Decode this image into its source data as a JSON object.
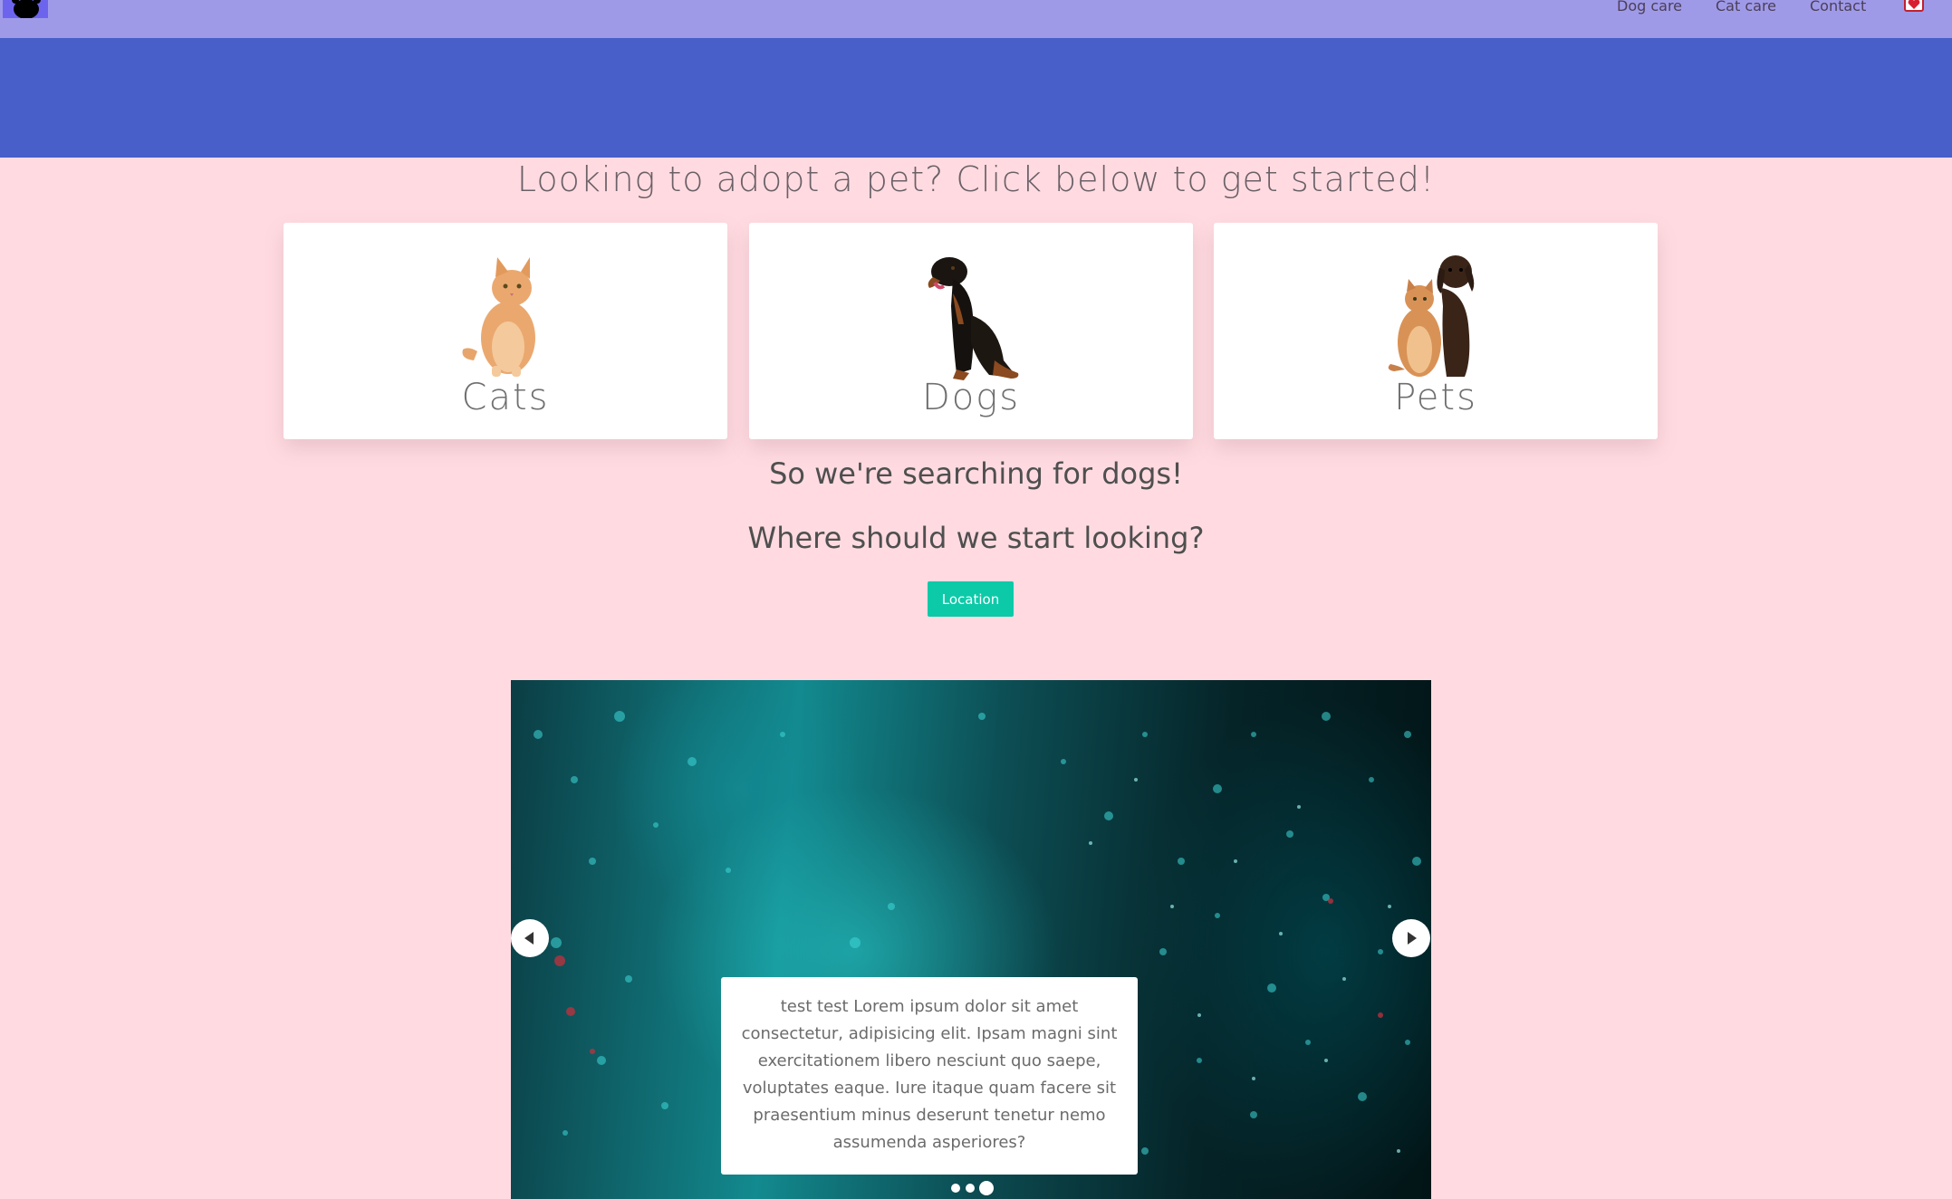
{
  "nav": {
    "logo": "paw-logo",
    "links": [
      {
        "label": "Dog care"
      },
      {
        "label": "Cat care"
      },
      {
        "label": "Contact"
      }
    ],
    "heart_icon": "heart-icon"
  },
  "hero": {
    "headline": "Looking to adopt a pet? Click below to get started!"
  },
  "cards": [
    {
      "label": "Cats",
      "image": "cat-photo"
    },
    {
      "label": "Dogs",
      "image": "dog-photo"
    },
    {
      "label": "Pets",
      "image": "cat-and-dog-photo"
    }
  ],
  "search": {
    "line1": "So we're searching for dogs!",
    "line2": "Where should we start looking?",
    "button_label": "Location"
  },
  "carousel": {
    "caption": "test test Lorem ipsum dolor sit amet consectetur, adipisicing elit. Ipsam magni sint exercitationem libero nesciunt quo saepe, voluptates eaque. Iure itaque quam facere sit praesentium minus deserunt tenetur nemo assumenda asperiores?",
    "slide_count": 3,
    "active_slide": 3
  },
  "colors": {
    "page_bg": "#ffdbe1",
    "navbar": "#9f9ae8",
    "hero_band": "#485ec9",
    "button": "#0ccaa8"
  }
}
